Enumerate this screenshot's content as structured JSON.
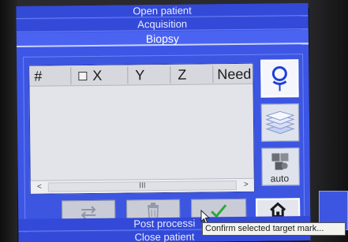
{
  "menu": {
    "open_patient": "Open patient",
    "acquisition": "Acquisition",
    "biopsy": "Biopsy",
    "post_processing": "Post processi",
    "close_patient": "Close patient"
  },
  "target_list": {
    "columns": [
      "#",
      "X",
      "Y",
      "Z",
      "Need"
    ],
    "rows": [],
    "scroll_left": "<",
    "scroll_right": ">",
    "scroll_thumb": "III"
  },
  "side_buttons": [
    {
      "icon": "target-marker-icon",
      "selected": true
    },
    {
      "icon": "layers-stack-icon",
      "selected": false
    },
    {
      "icon": "auto-puzzle-icon",
      "label": "auto",
      "selected": false
    }
  ],
  "bottom_buttons": [
    {
      "icon": "swap-arrows-icon"
    },
    {
      "icon": "trash-icon"
    },
    {
      "icon": "checkmark-icon"
    },
    {
      "icon": "home-icon"
    }
  ],
  "tooltip": "Confirm selected target mark...",
  "colors": {
    "screen_blue": "#3d56e6",
    "list_background": "#e3e4e9",
    "button_gray": "#c9ccd6",
    "check_green": "#2fa83a"
  }
}
